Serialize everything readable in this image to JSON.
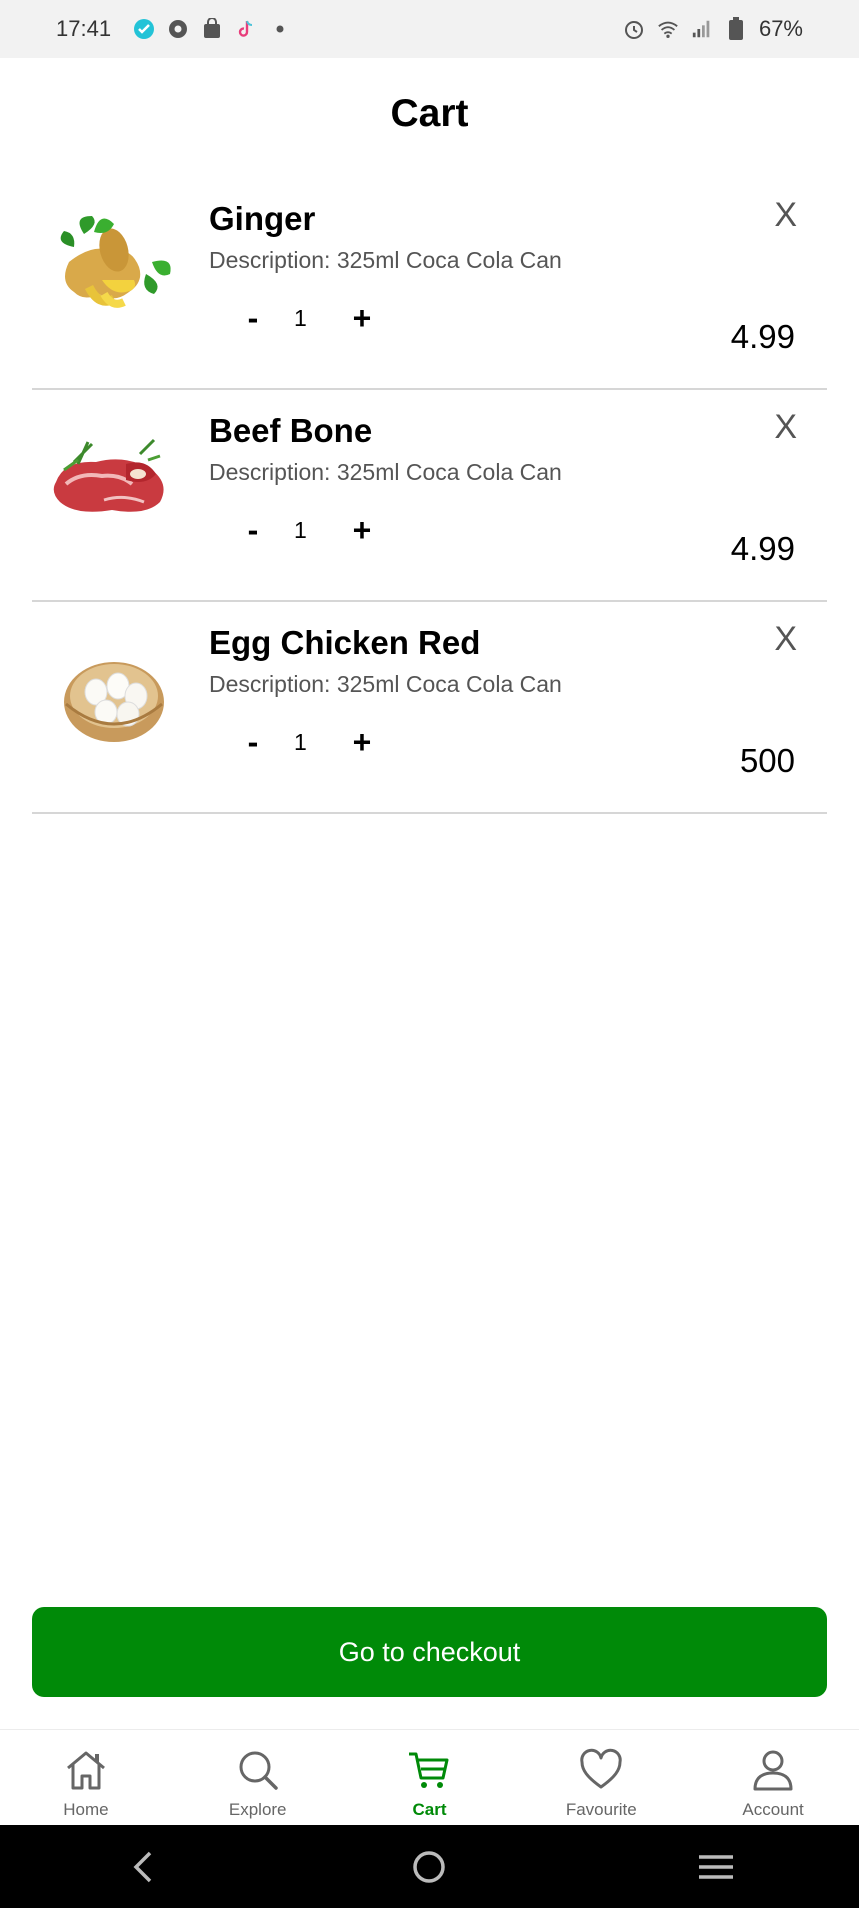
{
  "status_bar": {
    "time": "17:41",
    "battery": "67%"
  },
  "header": {
    "title": "Cart"
  },
  "cart": {
    "items": [
      {
        "name": "Ginger",
        "description": "Description: 325ml Coca Cola Can",
        "quantity": "1",
        "price": "4.99",
        "minus": "-",
        "plus": "+",
        "remove": "X",
        "image": "ginger-image"
      },
      {
        "name": "Beef Bone",
        "description": "Description: 325ml Coca Cola Can",
        "quantity": "1",
        "price": "4.99",
        "minus": "-",
        "plus": "+",
        "remove": "X",
        "image": "beef-image"
      },
      {
        "name": "Egg Chicken Red",
        "description": "Description: 325ml Coca Cola Can",
        "quantity": "1",
        "price": "500",
        "minus": "-",
        "plus": "+",
        "remove": "X",
        "image": "eggs-image"
      }
    ]
  },
  "checkout": {
    "label": "Go to checkout"
  },
  "nav": {
    "items": [
      {
        "label": "Home",
        "icon": "home-icon"
      },
      {
        "label": "Explore",
        "icon": "search-icon"
      },
      {
        "label": "Cart",
        "icon": "cart-icon",
        "active": true
      },
      {
        "label": "Favourite",
        "icon": "heart-icon"
      },
      {
        "label": "Account",
        "icon": "user-icon"
      }
    ]
  },
  "colors": {
    "accent": "#008a08",
    "divider": "#d6d6d6",
    "status_bar": "#f2f2f2"
  }
}
